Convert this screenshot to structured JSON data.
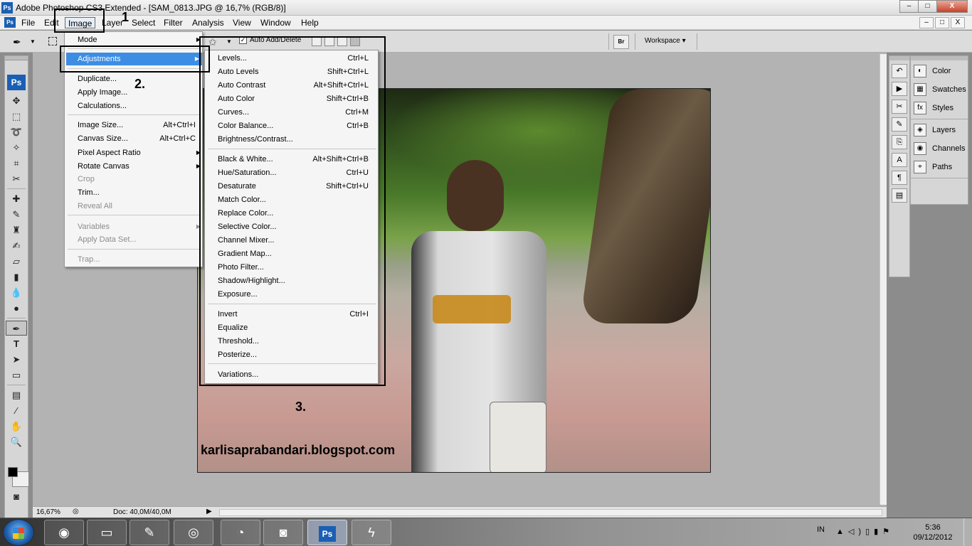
{
  "window": {
    "app_badge": "Ps",
    "title": "Adobe Photoshop CS3 Extended - [SAM_0813.JPG @ 16,7% (RGB/8)]",
    "buttons": [
      "–",
      "□",
      "X"
    ]
  },
  "menubar": {
    "doc_badge": "Ps",
    "items": [
      "File",
      "Edit",
      "Image",
      "Layer",
      "Select",
      "Filter",
      "Analysis",
      "View",
      "Window",
      "Help"
    ],
    "active": "Image",
    "mdi_buttons": [
      "–",
      "□",
      "X"
    ]
  },
  "options_bar": {
    "auto_add_delete_label": "Auto Add/Delete",
    "auto_add_delete_checked": true,
    "checkmark": "✓",
    "bridge_label": "Br",
    "workspace_label": "Workspace ▾"
  },
  "toolbox": {
    "badge": "Ps",
    "tools": [
      "move-tool",
      "marquee-tool",
      "lasso-tool",
      "magic-wand-tool",
      "crop-tool",
      "slice-tool",
      "healing-brush-tool",
      "brush-tool",
      "clone-stamp-tool",
      "history-brush-tool",
      "eraser-tool",
      "gradient-tool",
      "blur-tool",
      "dodge-tool",
      "pen-tool",
      "type-tool",
      "path-selection-tool",
      "shape-tool",
      "notes-tool",
      "eyedropper-tool",
      "hand-tool",
      "zoom-tool"
    ],
    "selected_tool": "pen-tool"
  },
  "image_menu": {
    "items": [
      {
        "label": "Mode",
        "shortcut": "",
        "submenu": true,
        "disabled": false,
        "highlighted": false
      },
      {
        "label": "Adjustments",
        "shortcut": "",
        "submenu": true,
        "disabled": false,
        "highlighted": true
      },
      {
        "label": "Duplicate...",
        "shortcut": "",
        "submenu": false,
        "disabled": false,
        "highlighted": false
      },
      {
        "label": "Apply Image...",
        "shortcut": "",
        "submenu": false,
        "disabled": false,
        "highlighted": false
      },
      {
        "label": "Calculations...",
        "shortcut": "",
        "submenu": false,
        "disabled": false,
        "highlighted": false
      },
      {
        "label": "Image Size...",
        "shortcut": "Alt+Ctrl+I",
        "submenu": false,
        "disabled": false,
        "highlighted": false
      },
      {
        "label": "Canvas Size...",
        "shortcut": "Alt+Ctrl+C",
        "submenu": false,
        "disabled": false,
        "highlighted": false
      },
      {
        "label": "Pixel Aspect Ratio",
        "shortcut": "",
        "submenu": true,
        "disabled": false,
        "highlighted": false
      },
      {
        "label": "Rotate Canvas",
        "shortcut": "",
        "submenu": true,
        "disabled": false,
        "highlighted": false
      },
      {
        "label": "Crop",
        "shortcut": "",
        "submenu": false,
        "disabled": true,
        "highlighted": false
      },
      {
        "label": "Trim...",
        "shortcut": "",
        "submenu": false,
        "disabled": false,
        "highlighted": false
      },
      {
        "label": "Reveal All",
        "shortcut": "",
        "submenu": false,
        "disabled": true,
        "highlighted": false
      },
      {
        "label": "Variables",
        "shortcut": "",
        "submenu": true,
        "disabled": true,
        "highlighted": false
      },
      {
        "label": "Apply Data Set...",
        "shortcut": "",
        "submenu": false,
        "disabled": true,
        "highlighted": false
      },
      {
        "label": "Trap...",
        "shortcut": "",
        "submenu": false,
        "disabled": true,
        "highlighted": false
      }
    ]
  },
  "adjustments_menu": {
    "items": [
      {
        "label": "Levels...",
        "shortcut": "Ctrl+L"
      },
      {
        "label": "Auto Levels",
        "shortcut": "Shift+Ctrl+L"
      },
      {
        "label": "Auto Contrast",
        "shortcut": "Alt+Shift+Ctrl+L"
      },
      {
        "label": "Auto Color",
        "shortcut": "Shift+Ctrl+B"
      },
      {
        "label": "Curves...",
        "shortcut": "Ctrl+M"
      },
      {
        "label": "Color Balance...",
        "shortcut": "Ctrl+B"
      },
      {
        "label": "Brightness/Contrast...",
        "shortcut": ""
      },
      {
        "label": "Black & White...",
        "shortcut": "Alt+Shift+Ctrl+B"
      },
      {
        "label": "Hue/Saturation...",
        "shortcut": "Ctrl+U"
      },
      {
        "label": "Desaturate",
        "shortcut": "Shift+Ctrl+U"
      },
      {
        "label": "Match Color...",
        "shortcut": ""
      },
      {
        "label": "Replace Color...",
        "shortcut": ""
      },
      {
        "label": "Selective Color...",
        "shortcut": ""
      },
      {
        "label": "Channel Mixer...",
        "shortcut": ""
      },
      {
        "label": "Gradient Map...",
        "shortcut": ""
      },
      {
        "label": "Photo Filter...",
        "shortcut": ""
      },
      {
        "label": "Shadow/Highlight...",
        "shortcut": ""
      },
      {
        "label": "Exposure...",
        "shortcut": ""
      },
      {
        "label": "Invert",
        "shortcut": "Ctrl+I"
      },
      {
        "label": "Equalize",
        "shortcut": ""
      },
      {
        "label": "Threshold...",
        "shortcut": ""
      },
      {
        "label": "Posterize...",
        "shortcut": ""
      },
      {
        "label": "Variations...",
        "shortcut": ""
      }
    ]
  },
  "annotations": {
    "step1": "1",
    "step2": "2.",
    "step3": "3."
  },
  "canvas": {
    "caption": "karlisaprabandari.blogspot.com"
  },
  "statusbar": {
    "zoom": "16,67%",
    "doc": "Doc: 40,0M/40,0M"
  },
  "panels": {
    "group1": [
      "Color",
      "Swatches",
      "Styles"
    ],
    "group2": [
      "Layers",
      "Channels",
      "Paths"
    ]
  },
  "taskbar": {
    "apps": [
      "firefox",
      "windows-explorer",
      "paint",
      "chrome",
      "media-player",
      "camera",
      "photoshop",
      "winamp"
    ],
    "active_app": "photoshop",
    "language": "IN",
    "time": "5:36",
    "date": "09/12/2012"
  }
}
